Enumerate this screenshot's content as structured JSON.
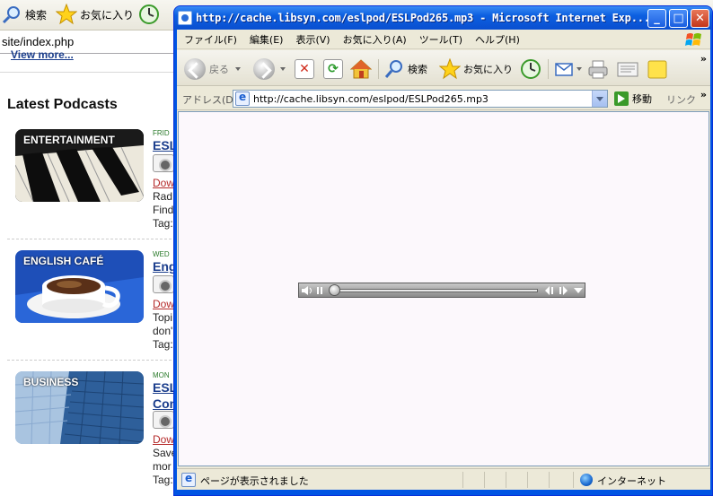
{
  "background_browser": {
    "toolbar": {
      "search_label": "検索",
      "favorites_label": "お気に入り"
    },
    "address_text": "site/index.php",
    "page": {
      "view_more": "View more...",
      "heading": "Latest Podcasts",
      "podcasts": [
        {
          "category": "ENTERTAINMENT",
          "day": "FRID",
          "title": "ESL",
          "download": "Dow",
          "line1": "Rad",
          "line2": "Find",
          "tags": "Tag:"
        },
        {
          "category": "ENGLISH CAFÉ",
          "day": "WED",
          "title": "Eng",
          "download": "Dow",
          "line1": "Topi",
          "line2": "don'",
          "tags": "Tag:"
        },
        {
          "category": "BUSINESS",
          "day": "MON",
          "title": "ESL",
          "title2": "Com",
          "download": "Dow",
          "line1": "Save",
          "line2": "mor",
          "tags": "Tag:"
        }
      ]
    }
  },
  "window": {
    "title": "http://cache.libsyn.com/eslpod/ESLPod265.mp3 - Microsoft Internet Exp...",
    "buttons": {
      "minimize": "_",
      "maximize": "□",
      "close": "✕"
    },
    "menu": [
      "ファイル(F)",
      "編集(E)",
      "表示(V)",
      "お気に入り(A)",
      "ツール(T)",
      "ヘルプ(H)"
    ],
    "toolbar": {
      "back_label": "戻る",
      "search_label": "検索",
      "favorites_label": "お気に入り",
      "more": "»"
    },
    "address": {
      "label": "アドレス(D)",
      "url": "http://cache.libsyn.com/eslpod/ESLPod265.mp3",
      "go_label": "移動",
      "links_label": "リンク",
      "more": "»"
    },
    "player": {
      "progress": 0.0
    },
    "status": {
      "text": "ページが表示されました",
      "zone": "インターネット"
    }
  }
}
